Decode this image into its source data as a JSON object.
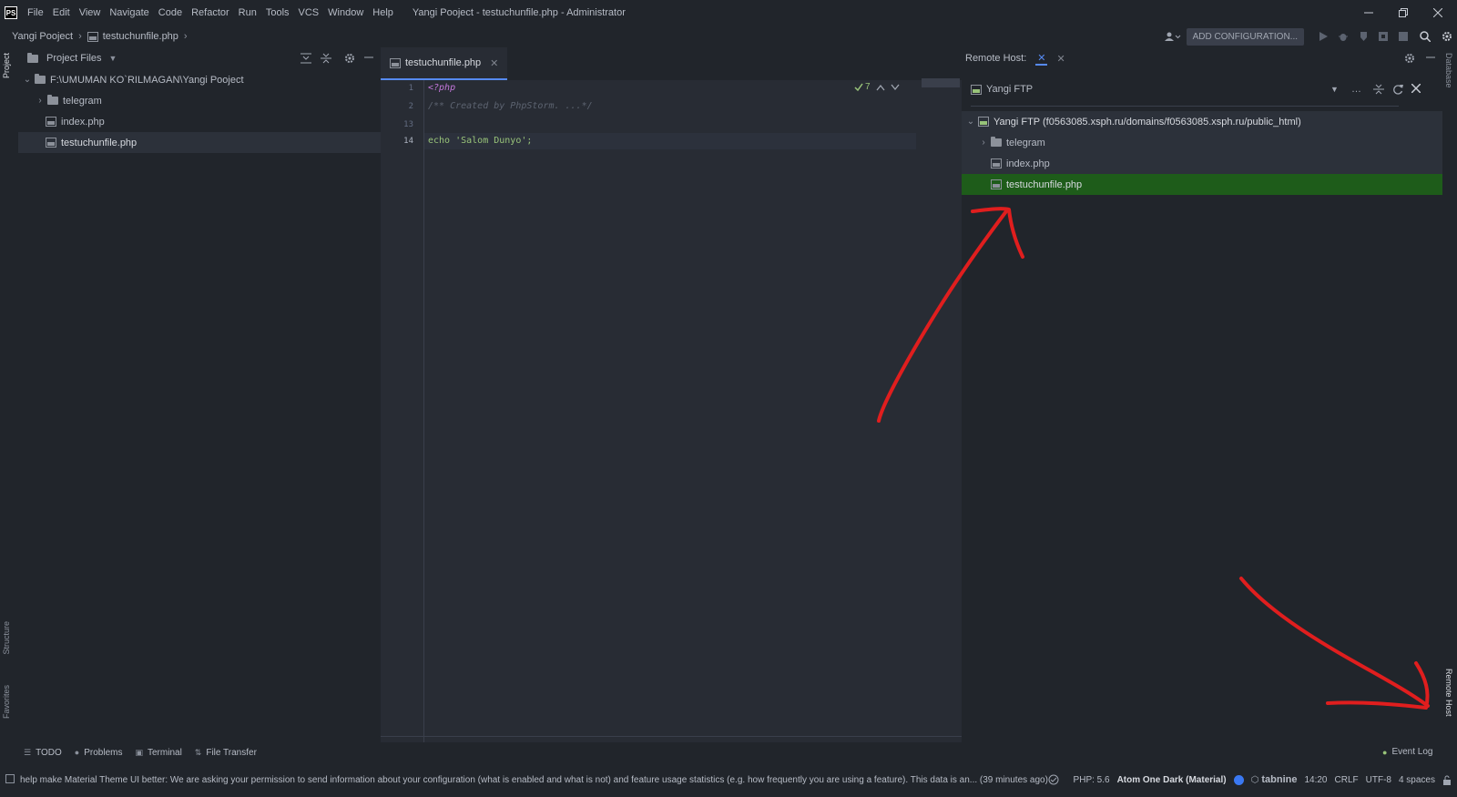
{
  "app": {
    "logo": "PS",
    "window_title": "Yangi Pooject - testuchunfile.php - Administrator"
  },
  "menu": [
    {
      "label": "File"
    },
    {
      "label": "Edit"
    },
    {
      "label": "View"
    },
    {
      "label": "Navigate"
    },
    {
      "label": "Code"
    },
    {
      "label": "Refactor"
    },
    {
      "label": "Run"
    },
    {
      "label": "Tools"
    },
    {
      "label": "VCS"
    },
    {
      "label": "Window"
    },
    {
      "label": "Help"
    }
  ],
  "breadcrumb": {
    "project": "Yangi Pooject",
    "file": "testuchunfile.php"
  },
  "toolbar": {
    "add_configuration": "ADD CONFIGURATION..."
  },
  "left_strip": {
    "project": "Project",
    "structure": "Structure",
    "favorites": "Favorites"
  },
  "project_panel": {
    "view_label": "Project Files",
    "root": "F:\\UMUMAN KO`RILMAGAN\\Yangi Pooject",
    "items": [
      {
        "label": "telegram",
        "type": "folder"
      },
      {
        "label": "index.php",
        "type": "file"
      },
      {
        "label": "testuchunfile.php",
        "type": "file"
      }
    ]
  },
  "editor": {
    "tab_label": "testuchunfile.php",
    "inspection_count": "7",
    "lines": [
      {
        "no": "1",
        "text": "<?php"
      },
      {
        "no": "2",
        "text": "/** Created by PhpStorm. ...*/"
      },
      {
        "no": "13",
        "text": ""
      },
      {
        "no": "14",
        "text": "echo 'Salom Dunyo';"
      }
    ]
  },
  "remote_host": {
    "header_label": "Remote Host:",
    "server_name": "Yangi FTP",
    "root": "Yangi FTP (f0563085.xsph.ru/domains/f0563085.xsph.ru/public_html)",
    "items": [
      {
        "label": "telegram",
        "type": "folder"
      },
      {
        "label": "index.php",
        "type": "file"
      },
      {
        "label": "testuchunfile.php",
        "type": "file",
        "highlighted": true
      }
    ]
  },
  "right_strip": {
    "database": "Database",
    "remote_host": "Remote Host"
  },
  "bottom_tools": [
    {
      "label": "TODO"
    },
    {
      "label": "Problems"
    },
    {
      "label": "Terminal"
    },
    {
      "label": "File Transfer"
    }
  ],
  "event_log": "Event Log",
  "status": {
    "message": "help make Material Theme UI better: We are asking your permission to send information about your configuration (what is enabled and what is not) and feature usage statistics (e.g. how frequently you are using a feature). This data is an... (39 minutes ago)",
    "php": "PHP: 5.6",
    "theme": "Atom One Dark (Material)",
    "tabnine": "tabnine",
    "position": "14:20",
    "line_sep": "CRLF",
    "encoding": "UTF-8",
    "indent": "4 spaces"
  },
  "colors": {
    "accent": "#568af2",
    "highlight_green": "#1e5c1a",
    "annotation_red": "#e01e1e"
  }
}
